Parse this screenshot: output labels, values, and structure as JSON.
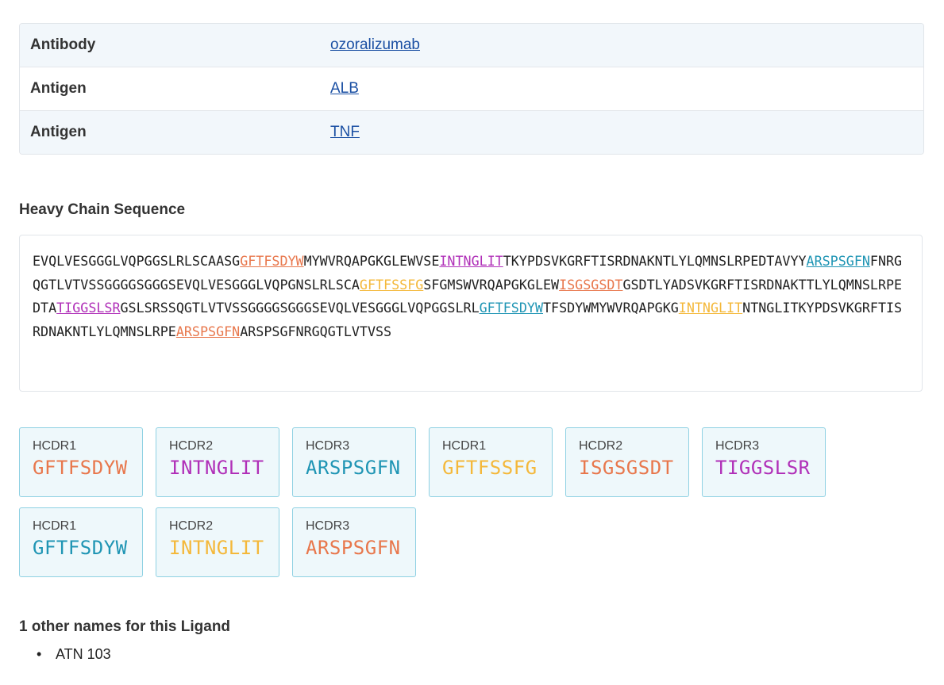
{
  "info_table": {
    "rows": [
      {
        "label": "Antibody",
        "value": "ozoralizumab"
      },
      {
        "label": "Antigen",
        "value": "ALB"
      },
      {
        "label": "Antigen",
        "value": "TNF"
      }
    ]
  },
  "heavy_chain": {
    "title": "Heavy Chain Sequence",
    "segments": [
      {
        "text": "EVQLVESGGGLVQPGGSLRLSCAASG",
        "color": "#222222",
        "underline": false
      },
      {
        "text": "GFTFSDYW",
        "color": "#e8774c",
        "underline": true
      },
      {
        "text": "MYWVRQAPGKGLEWVSE",
        "color": "#222222",
        "underline": false
      },
      {
        "text": "INTNGLIT",
        "color": "#b030b8",
        "underline": true
      },
      {
        "text": "TKYPDSVKGRFTISRDNAKNTLYLQMNSLRPEDTAVYY",
        "color": "#222222",
        "underline": false
      },
      {
        "text": "ARSPSGFN",
        "color": "#1f95b4",
        "underline": true
      },
      {
        "text": "FNRGQGTLVTVSSGGGGSGGGSEVQLVESGGGLVQPGNSLRLSCA",
        "color": "#222222",
        "underline": false
      },
      {
        "text": "GFTFSSFG",
        "color": "#f4b83a",
        "underline": true
      },
      {
        "text": "SFGMSWVRQAPGKGLEW",
        "color": "#222222",
        "underline": false
      },
      {
        "text": "ISGSGSDT",
        "color": "#e8774c",
        "underline": true
      },
      {
        "text": "GSDTLYADSVKGRFTISRDNAKTTLYLQMNSLRPEDTA",
        "color": "#222222",
        "underline": false
      },
      {
        "text": "TIGGSLSR",
        "color": "#b030b8",
        "underline": true
      },
      {
        "text": "GSLSRSSQGTLVTVSSGGGGSGGGSEVQLVESGGGLVQPGGSLRL",
        "color": "#222222",
        "underline": false
      },
      {
        "text": "GFTFSDYW",
        "color": "#1f95b4",
        "underline": true
      },
      {
        "text": "TFSDYWMYWVRQAPGKG",
        "color": "#222222",
        "underline": false
      },
      {
        "text": "INTNGLIT",
        "color": "#f4b83a",
        "underline": true
      },
      {
        "text": "NTNGLITKYPDSVKGRFTISRDNAKNTLYLQMNSLRPE",
        "color": "#222222",
        "underline": false
      },
      {
        "text": "ARSPSGFN",
        "color": "#e8774c",
        "underline": true
      },
      {
        "text": "ARSPSGFNRGQGTLVTVSS",
        "color": "#222222",
        "underline": false
      }
    ]
  },
  "cdrs": [
    {
      "label": "HCDR1",
      "seq": "GFTFSDYW",
      "color": "#e8774c"
    },
    {
      "label": "HCDR2",
      "seq": "INTNGLIT",
      "color": "#b030b8"
    },
    {
      "label": "HCDR3",
      "seq": "ARSPSGFN",
      "color": "#1f95b4"
    },
    {
      "label": "HCDR1",
      "seq": "GFTFSSFG",
      "color": "#f4b83a"
    },
    {
      "label": "HCDR2",
      "seq": "ISGSGSDT",
      "color": "#e8774c"
    },
    {
      "label": "HCDR3",
      "seq": "TIGGSLSR",
      "color": "#b030b8"
    },
    {
      "label": "HCDR1",
      "seq": "GFTFSDYW",
      "color": "#1f95b4"
    },
    {
      "label": "HCDR2",
      "seq": "INTNGLIT",
      "color": "#f4b83a"
    },
    {
      "label": "HCDR3",
      "seq": "ARSPSGFN",
      "color": "#e8774c"
    }
  ],
  "other_names": {
    "title": "1 other names for this Ligand",
    "items": [
      "ATN 103"
    ]
  }
}
